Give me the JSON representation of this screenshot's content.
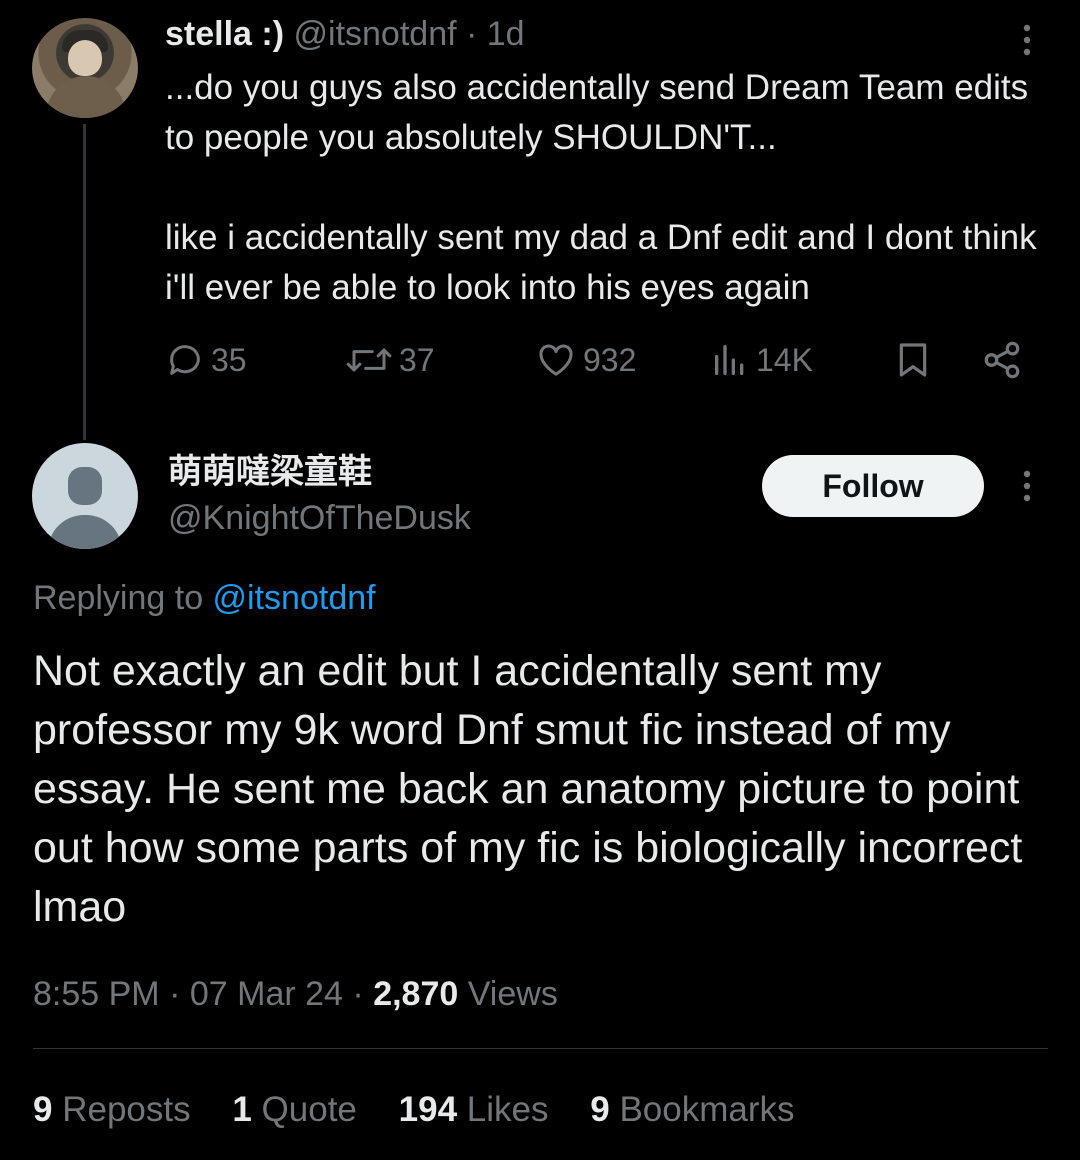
{
  "original": {
    "name": "stella :)",
    "handle": "@itsnotdnf",
    "age": "· 1d",
    "text_p1": "...do you guys also accidentally send Dream Team edits to people you absolutely SHOULDN'T...",
    "text_p2": "like i accidentally sent my dad a Dnf edit and I dont think i'll ever be able to look into his eyes again",
    "replies": "35",
    "reposts": "37",
    "likes": "932",
    "views": "14K"
  },
  "reply": {
    "name": "萌萌噠梁童鞋",
    "handle": "@KnightOfTheDusk",
    "follow_label": "Follow",
    "replying_prefix": "Replying to ",
    "replying_mention": "@itsnotdnf",
    "text": "Not exactly an edit but I accidentally sent my professor my 9k word Dnf smut fic instead of my essay. He sent me back an anatomy picture to point out how some parts of my fic is biologically incorrect lmao",
    "time": "8:55 PM",
    "date": "07 Mar 24",
    "views_count": "2,870",
    "views_label": "Views"
  },
  "stats": {
    "reposts_count": "9",
    "reposts_label": "Reposts",
    "quotes_count": "1",
    "quotes_label": "Quote",
    "likes_count": "194",
    "likes_label": "Likes",
    "bookmarks_count": "9",
    "bookmarks_label": "Bookmarks"
  },
  "icons": {
    "reply": "reply-icon",
    "repost": "repost-icon",
    "like": "heart-icon",
    "views": "views-chart-icon",
    "bookmark": "bookmark-icon",
    "share": "share-icon",
    "more": "more-vertical-icon"
  },
  "colors": {
    "background": "#000000",
    "text": "#e7e9ea",
    "muted": "#71767b",
    "link": "#1d9bf0",
    "follow_bg": "#eff3f4"
  }
}
